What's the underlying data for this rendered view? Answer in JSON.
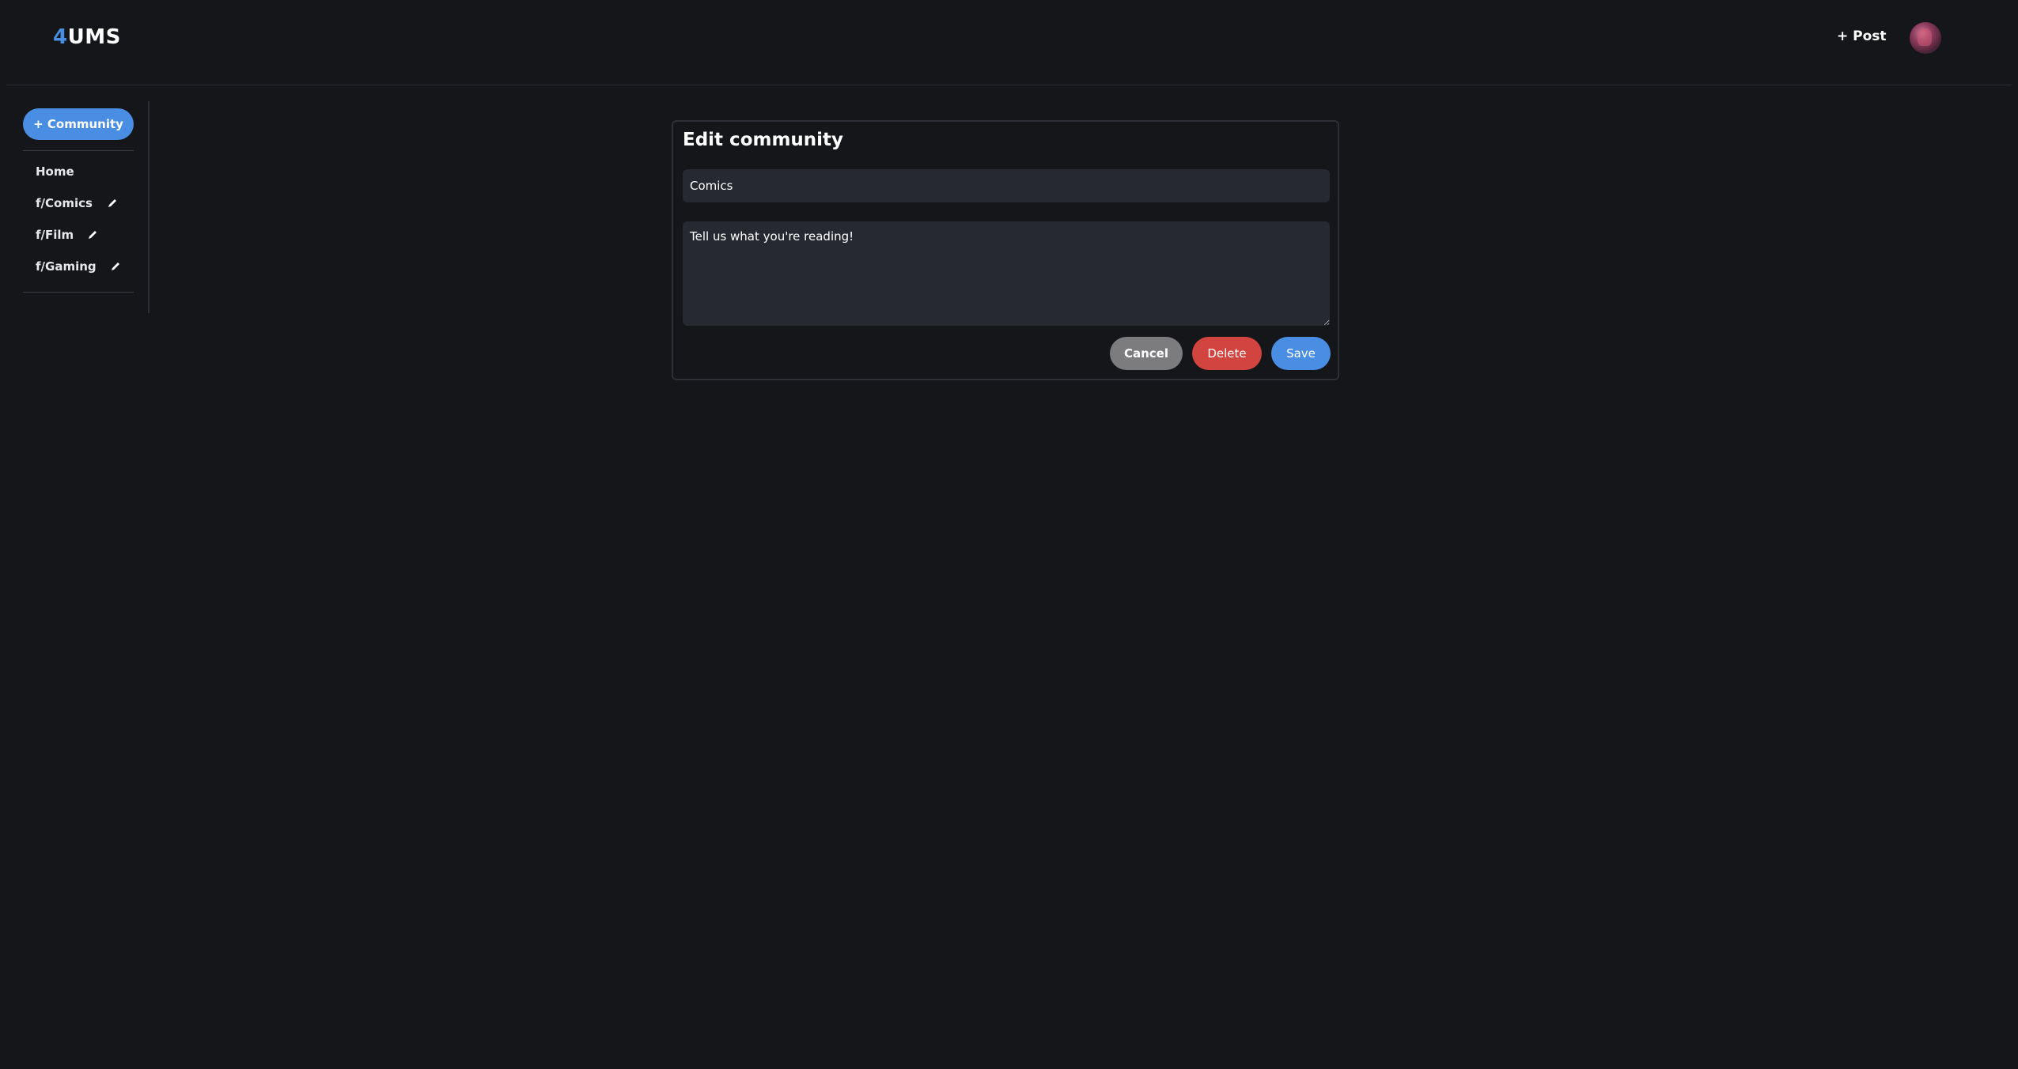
{
  "header": {
    "logo_accent": "4",
    "logo_rest": "UMS",
    "post_label": "+ Post"
  },
  "sidebar": {
    "community_button": "+ Community",
    "items": [
      {
        "label": "Home",
        "editable": false
      },
      {
        "label": "f/Comics",
        "editable": true
      },
      {
        "label": "f/Film",
        "editable": true
      },
      {
        "label": "f/Gaming",
        "editable": true
      }
    ]
  },
  "edit_card": {
    "title": "Edit community",
    "name_value": "Comics",
    "description_value": "Tell us what you're reading!",
    "cancel_label": "Cancel",
    "delete_label": "Delete",
    "save_label": "Save"
  },
  "colors": {
    "background": "#15161a",
    "accent": "#4a8ee3",
    "danger": "#d2443f",
    "neutral": "#7c7c7e",
    "input_bg": "#272931"
  },
  "icons": {
    "edit": "pencil-icon",
    "avatar": "user-avatar"
  }
}
